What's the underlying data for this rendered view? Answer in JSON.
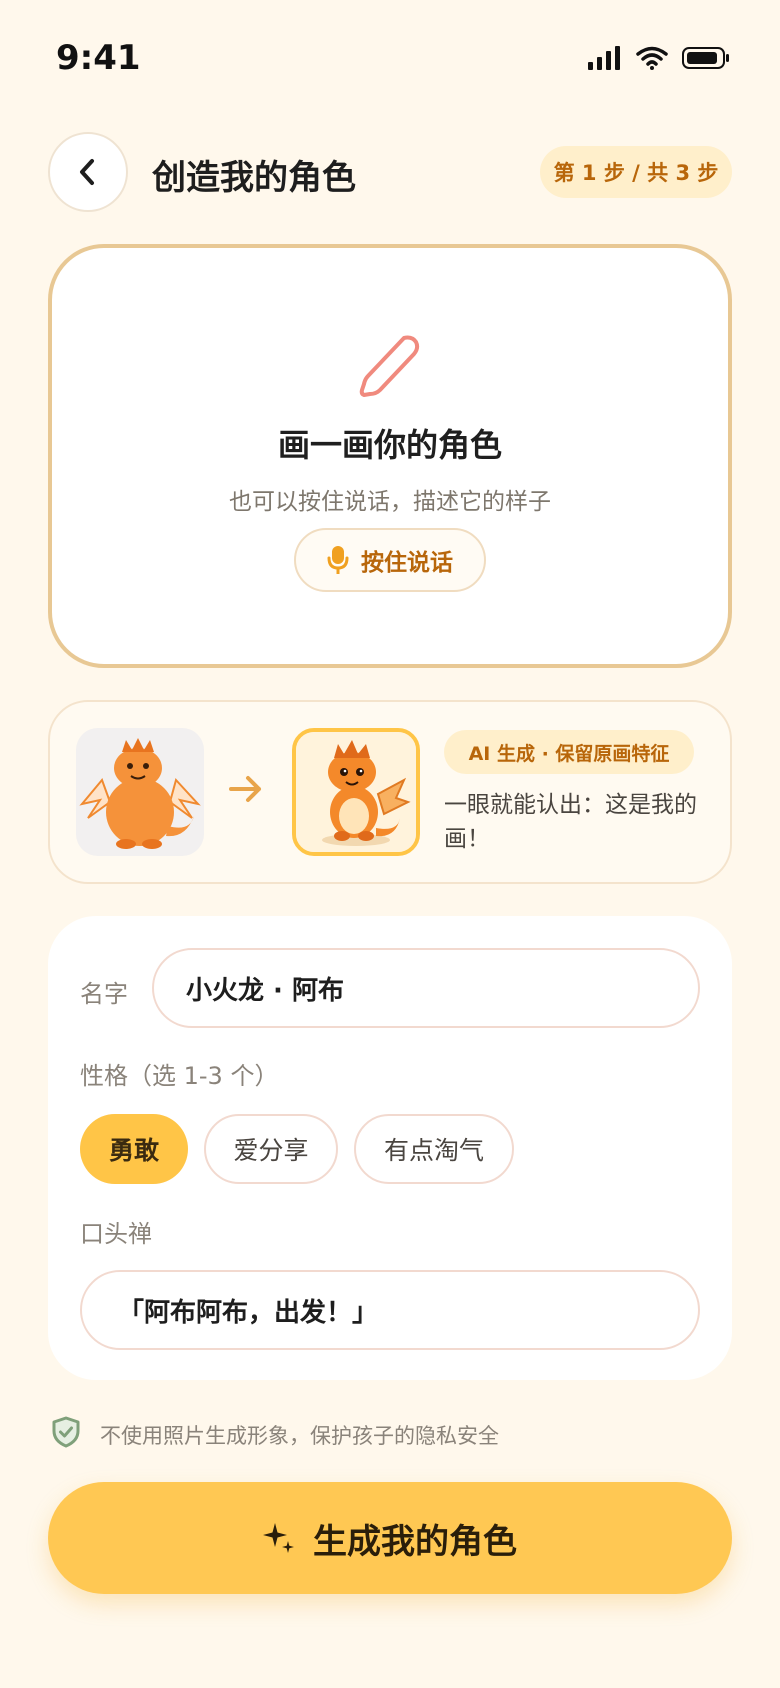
{
  "status_bar": {
    "time": "9:41"
  },
  "header": {
    "title": "创造我的角色",
    "step_badge": "第 1 步 / 共 3 步"
  },
  "draw_card": {
    "title": "画一画你的角色",
    "subtitle": "也可以按住说话，描述它的样子",
    "voice_button": "按住说话"
  },
  "ai_preview": {
    "badge": "AI 生成 · 保留原画特征",
    "description": "一眼就能认出：这是我的画！"
  },
  "form": {
    "name_label": "名字",
    "name_value": "小火龙 · 阿布",
    "trait_label": "性格（选 1-3 个）",
    "traits": [
      {
        "label": "勇敢",
        "selected": true
      },
      {
        "label": "爱分享",
        "selected": false
      },
      {
        "label": "有点淘气",
        "selected": false
      }
    ],
    "catchphrase_label": "口头禅",
    "catchphrase_value": "「阿布阿布，出发！」"
  },
  "privacy_note": "不使用照片生成形象，保护孩子的隐私安全",
  "generate_button": "生成我的角色",
  "colors": {
    "background": "#FFF8EC",
    "accent": "#FFC853",
    "accent_text": "#B8660A",
    "card_border": "#E8C894",
    "pencil": "#F08A7E",
    "shield": "#7FA07A"
  }
}
